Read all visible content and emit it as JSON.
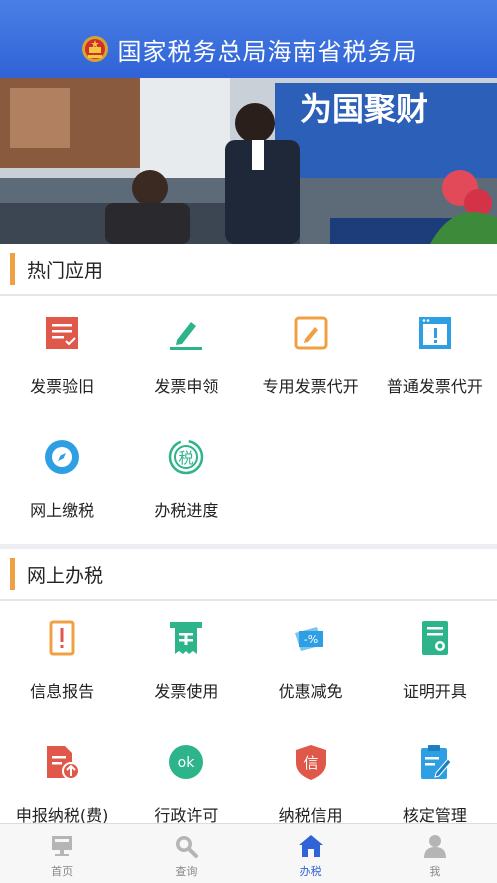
{
  "header": {
    "title": "国家税务总局海南省税务局",
    "emblem": "national-emblem-icon"
  },
  "banner": {
    "sign_text": "为国聚财",
    "description": "photo"
  },
  "hot_apps": {
    "title": "热门应用",
    "items": [
      {
        "label": "发票验旧",
        "icon": "invoice-check-icon",
        "color": "#e0584a"
      },
      {
        "label": "发票申领",
        "icon": "pen-icon",
        "color": "#2eb48a"
      },
      {
        "label": "专用发票代开",
        "icon": "edit-box-icon",
        "color": "#f0a043"
      },
      {
        "label": "普通发票代开",
        "icon": "window-icon",
        "color": "#2f9fe4"
      },
      {
        "label": "网上缴税",
        "icon": "compass-icon",
        "color": "#2f9fe4"
      },
      {
        "label": "办税进度",
        "icon": "tax-progress-icon",
        "color": "#2eb48a"
      }
    ]
  },
  "online_tax": {
    "title": "网上办税",
    "items": [
      {
        "label": "信息报告",
        "icon": "report-icon",
        "color": "#f0a043"
      },
      {
        "label": "发票使用",
        "icon": "receipt-icon",
        "color": "#2eb48a"
      },
      {
        "label": "优惠减免",
        "icon": "discount-icon",
        "color": "#2f9fe4"
      },
      {
        "label": "证明开具",
        "icon": "certificate-icon",
        "color": "#2eb48a"
      },
      {
        "label": "申报纳税(费)",
        "icon": "declare-upload-icon",
        "color": "#e0584a"
      },
      {
        "label": "行政许可",
        "icon": "ok-icon",
        "color": "#2eb48a"
      },
      {
        "label": "纳税信用",
        "icon": "credit-shield-icon",
        "color": "#e0584a"
      },
      {
        "label": "核定管理",
        "icon": "clipboard-icon",
        "color": "#2f9fe4"
      }
    ]
  },
  "ok_text": "ok",
  "tax_char": "税",
  "credit_char": "信",
  "discount_text": "-%",
  "tabbar": {
    "tabs": [
      {
        "label": "首页",
        "icon": "home-board-icon",
        "active": false
      },
      {
        "label": "查询",
        "icon": "search-icon",
        "active": false
      },
      {
        "label": "办税",
        "icon": "house-icon",
        "active": true
      },
      {
        "label": "我",
        "icon": "person-icon",
        "active": false
      }
    ],
    "active_color": "#2f63d6",
    "inactive_color": "#b5b5b5"
  }
}
